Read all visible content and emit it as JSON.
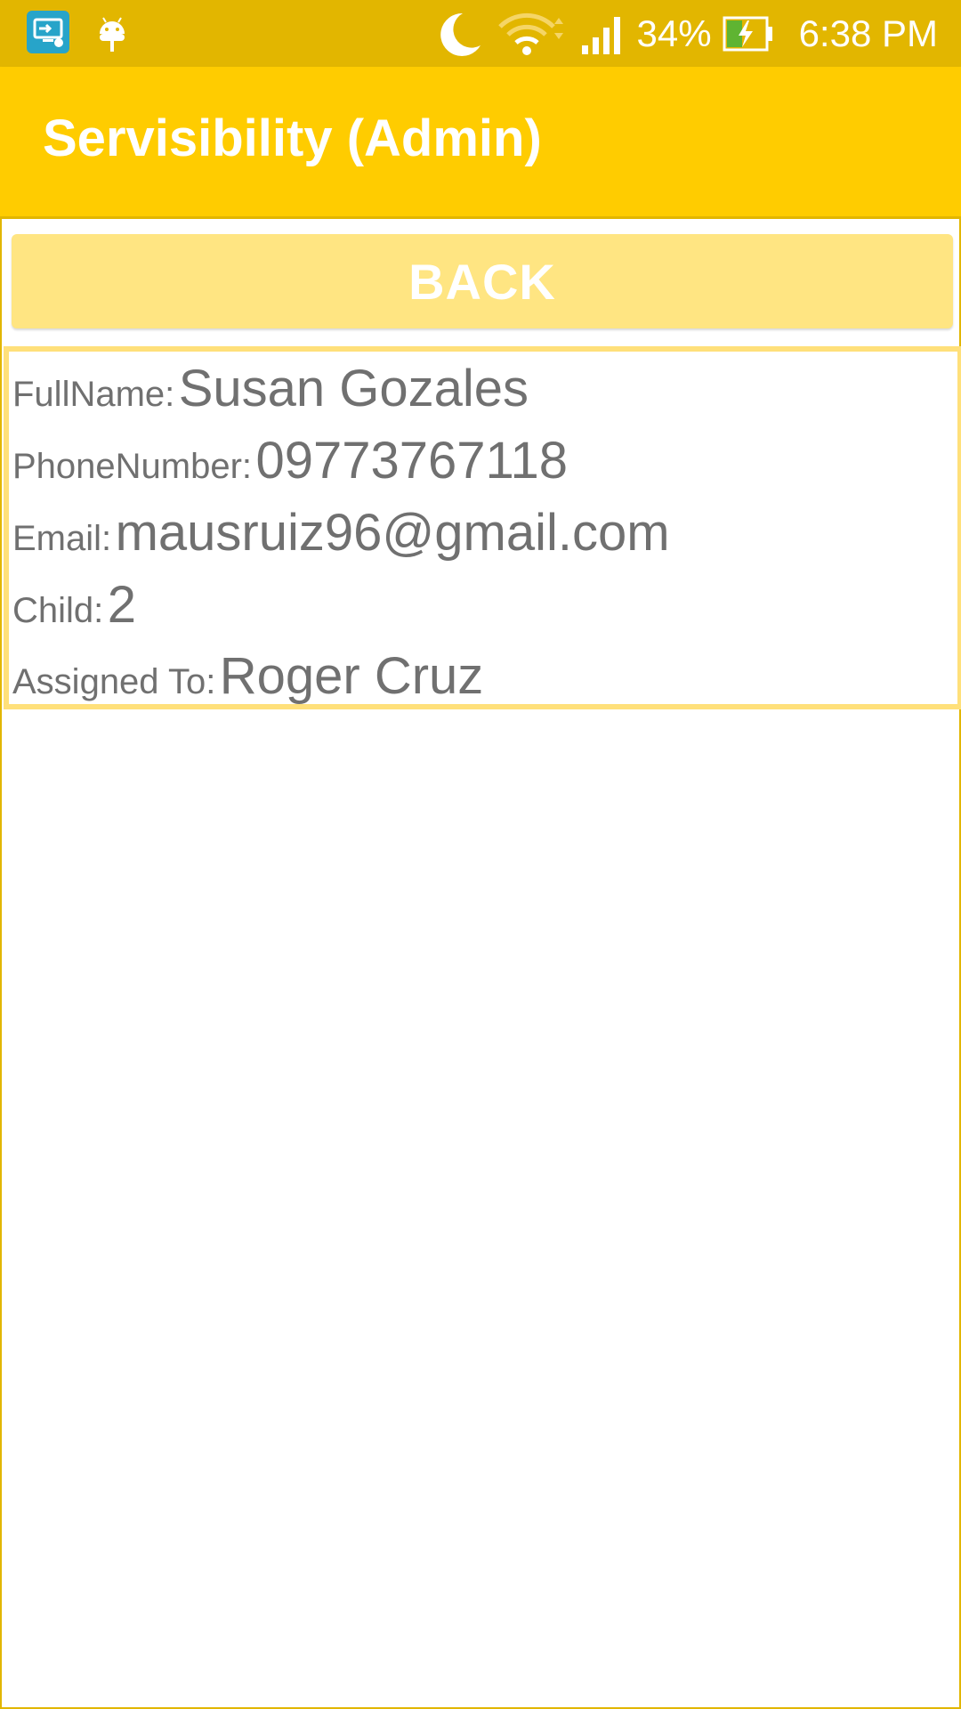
{
  "status_bar": {
    "battery_percent": "34%",
    "time": "6:38 PM",
    "icons": [
      "screen-cast-icon",
      "android-debug-icon",
      "do-not-disturb-moon-icon",
      "wifi-icon",
      "cellular-signal-icon",
      "battery-charging-icon"
    ]
  },
  "app_bar": {
    "title": "Servisibility (Admin)"
  },
  "back_button": {
    "label": "BACK"
  },
  "details": {
    "full_name": {
      "label": "FullName:",
      "value": "Susan Gozales"
    },
    "phone_number": {
      "label": "PhoneNumber:",
      "value": "09773767118"
    },
    "email": {
      "label": "Email:",
      "value": "mausruiz96@gmail.com"
    },
    "child": {
      "label": "Child:",
      "value": "2"
    },
    "assigned_to": {
      "label": "Assigned To:",
      "value": "Roger Cruz"
    }
  },
  "colors": {
    "status_bar": "#e2b600",
    "app_bar": "#ffcc00",
    "button": "#ffe582",
    "card_border": "#ffe07a",
    "text": "#707070"
  }
}
